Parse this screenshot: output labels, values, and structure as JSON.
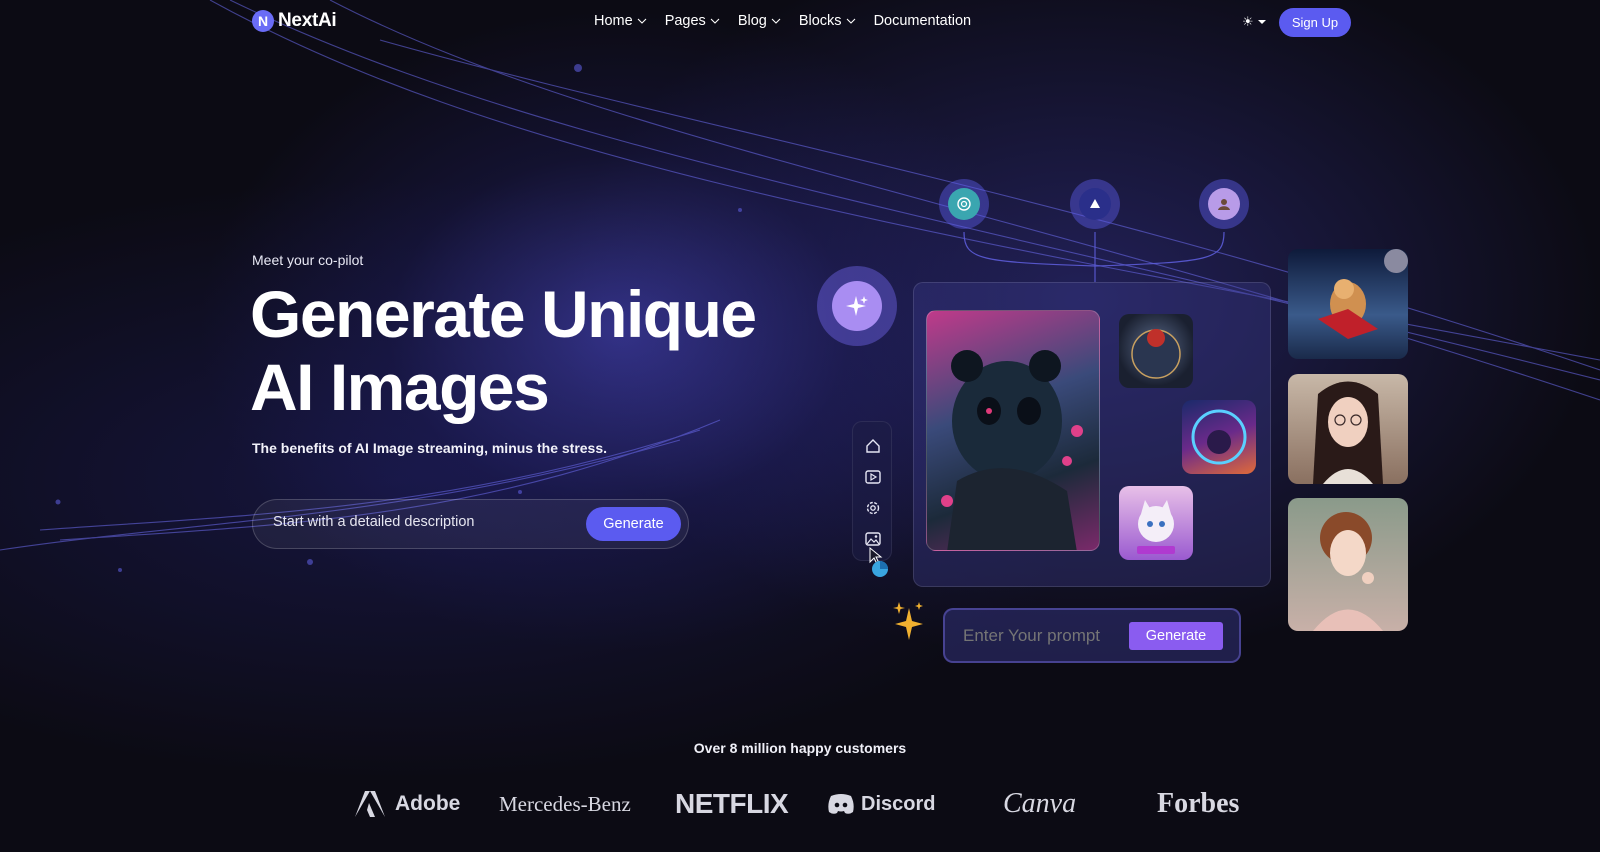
{
  "nav": {
    "logo": "NextAi",
    "logo_mark": "N",
    "menu": [
      {
        "label": "Home",
        "dropdown": true
      },
      {
        "label": "Pages",
        "dropdown": true
      },
      {
        "label": "Blog",
        "dropdown": true
      },
      {
        "label": "Blocks",
        "dropdown": true
      },
      {
        "label": "Documentation",
        "dropdown": false
      }
    ],
    "theme_toggle_icon": "sun-icon",
    "signup_label": "Sign Up"
  },
  "hero": {
    "eyebrow": "Meet your co-pilot",
    "title_line1": "Generate Unique",
    "title_line2": "AI Images",
    "subtitle": "The benefits of AI Image streaming, minus the stress.",
    "input_value": "Start with a detailed description",
    "generate_label": "Generate"
  },
  "showcase": {
    "top_icons": [
      "openai-icon",
      "sail-icon",
      "avatar-icon"
    ],
    "sidebar_tools": [
      "home-icon",
      "video-icon",
      "settings-icon",
      "image-icon"
    ],
    "prompt_placeholder": "Enter Your prompt",
    "prompt_generate_label": "Generate",
    "images": [
      "panda-image",
      "globe-tree-image",
      "portal-girl-image",
      "cat-image",
      "space-dog-image",
      "woman-glasses-image",
      "woman-portrait-image"
    ]
  },
  "customers": {
    "headline": "Over 8 million happy customers",
    "brands": [
      "Adobe",
      "Mercedes-Benz",
      "NETFLIX",
      "Discord",
      "Canva",
      "Forbes"
    ]
  },
  "colors": {
    "accent": "#5b5bf0",
    "prompt_button": "#8a5cf0",
    "background": "#0c0b14"
  }
}
